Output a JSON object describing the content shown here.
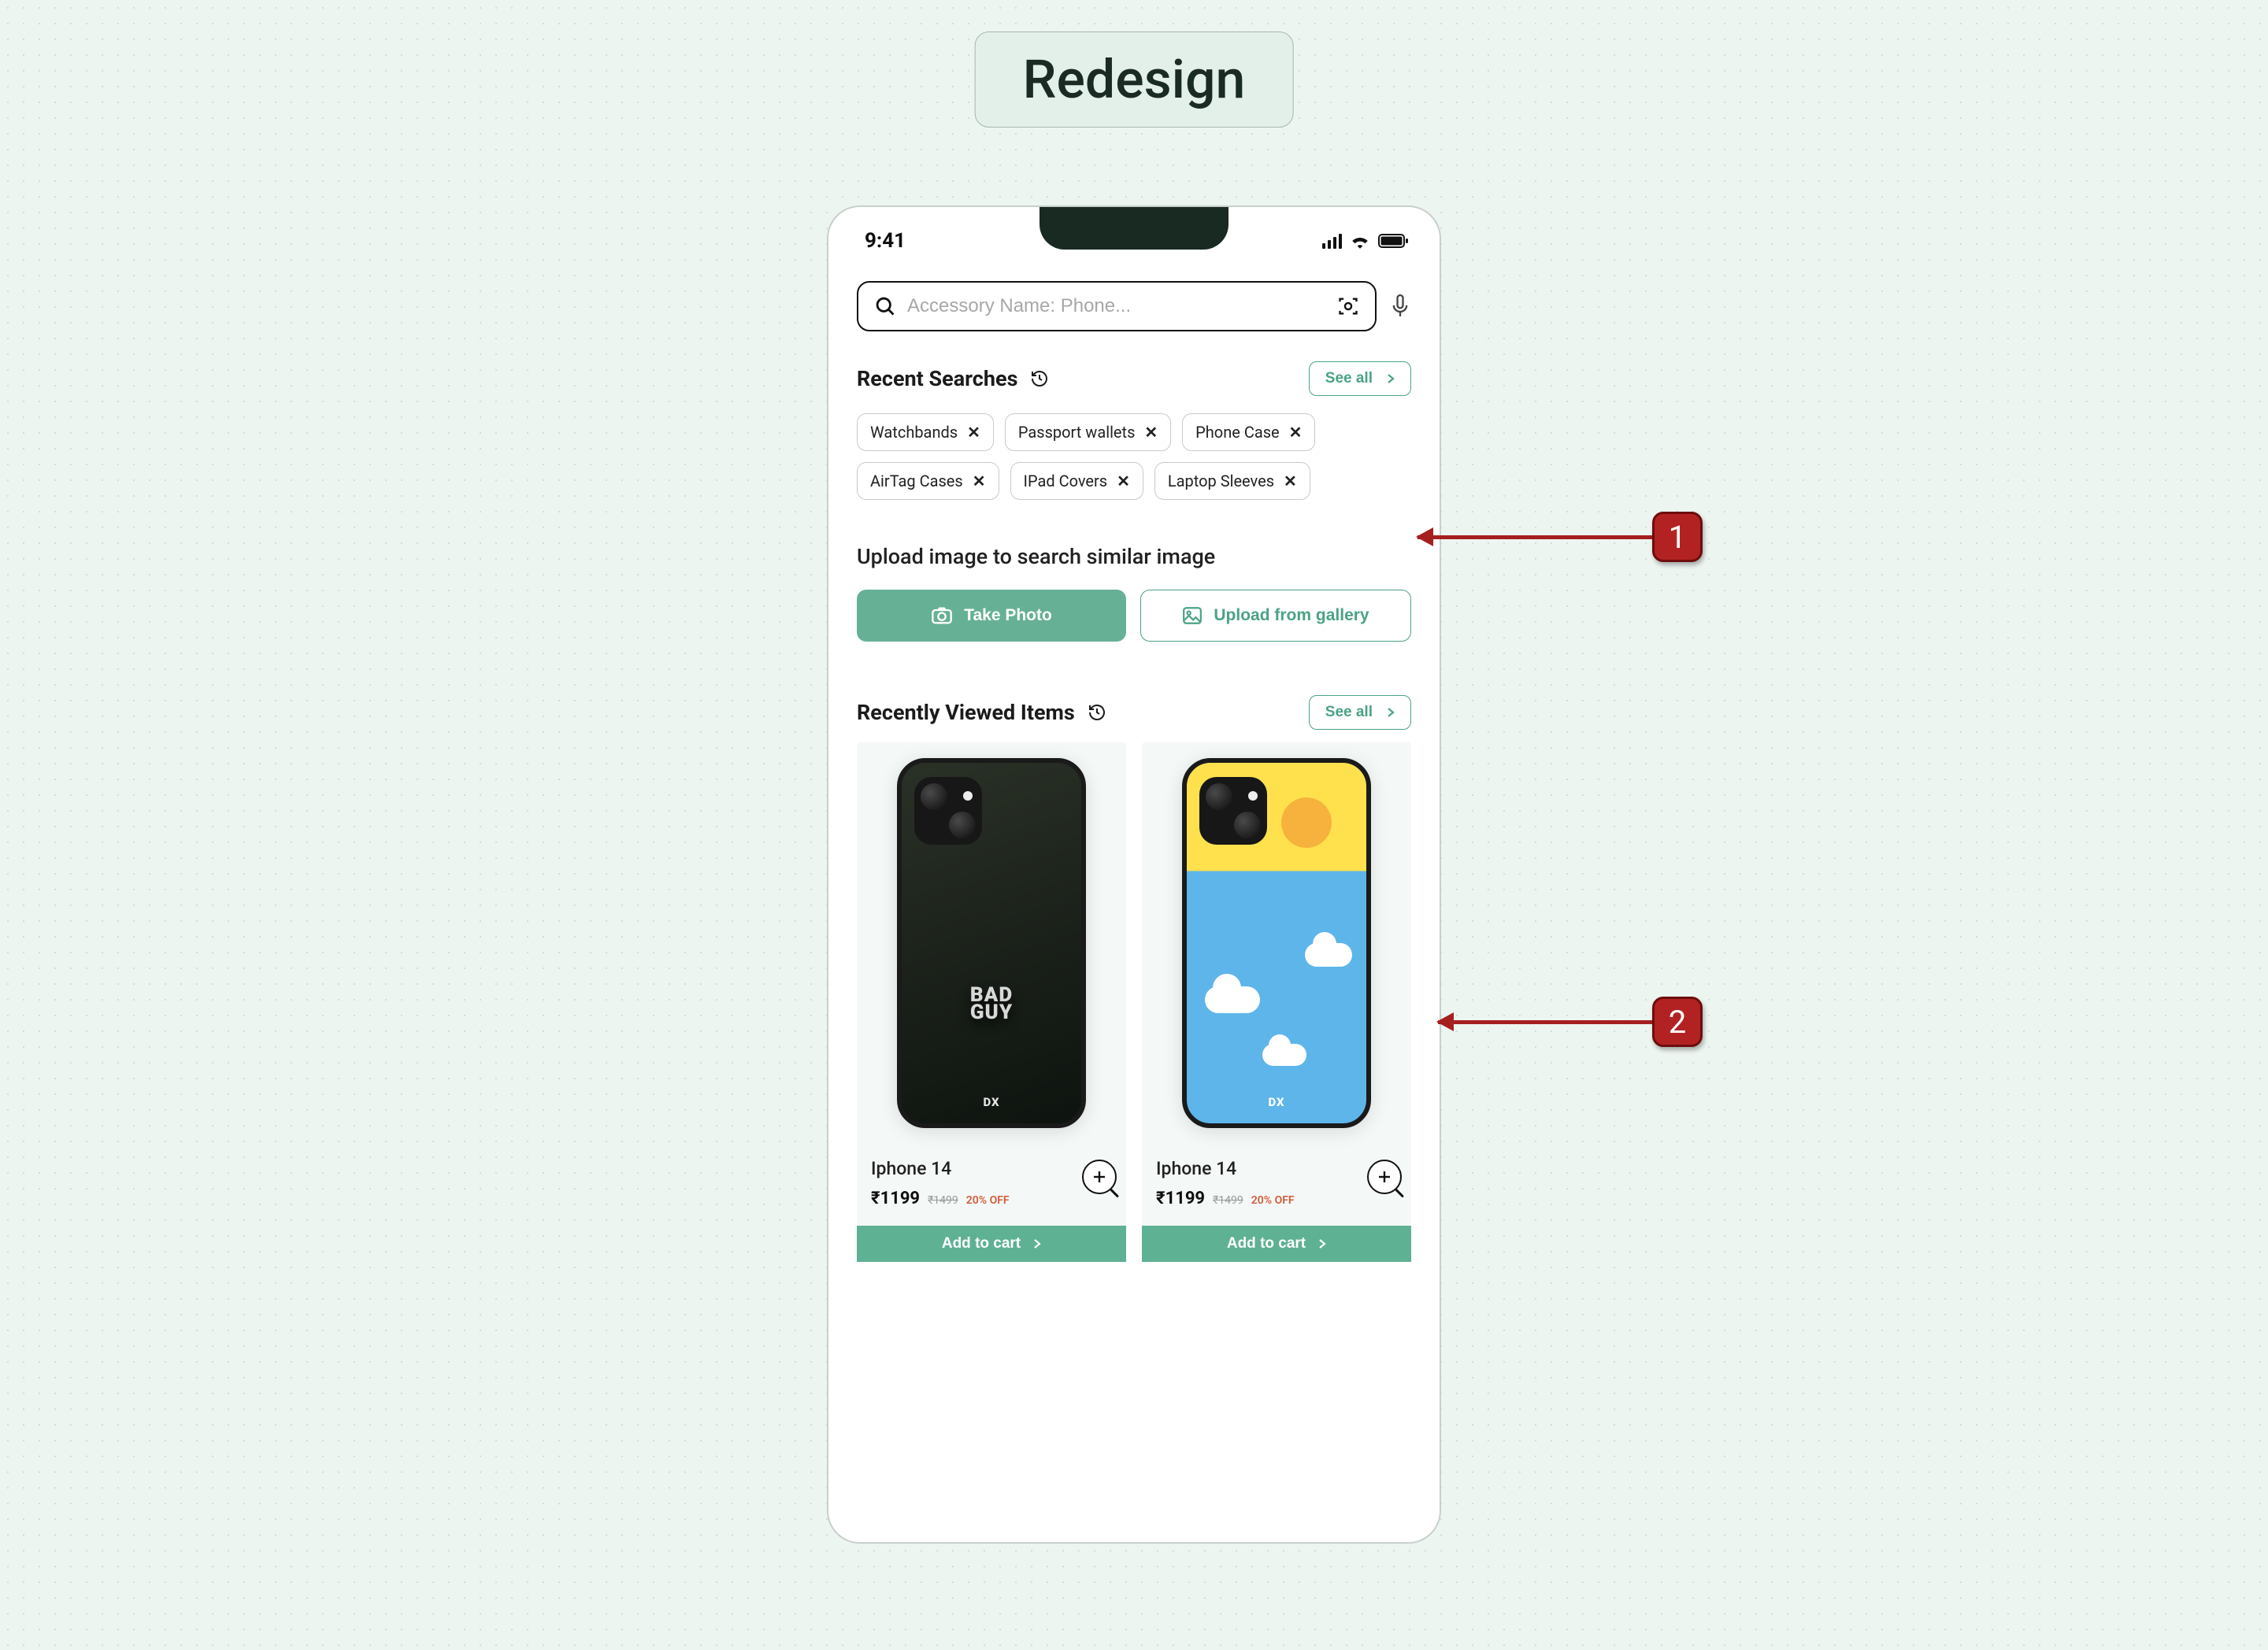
{
  "header": {
    "title": "Redesign"
  },
  "statusBar": {
    "time": "9:41"
  },
  "search": {
    "placeholder": "Accessory Name: Phone..."
  },
  "recent": {
    "title": "Recent Searches",
    "seeAll": "See all",
    "chips": [
      "Watchbands",
      "Passport wallets",
      "Phone Case",
      "AirTag Cases",
      "IPad Covers",
      "Laptop Sleeves"
    ]
  },
  "upload": {
    "title": "Upload image to search similar image",
    "takePhoto": "Take Photo",
    "gallery": "Upload from gallery"
  },
  "viewed": {
    "title": "Recently Viewed Items",
    "seeAll": "See all"
  },
  "products": [
    {
      "name": "Iphone 14",
      "price": "₹1199",
      "orig": "₹1499",
      "discount": "20% OFF",
      "cart": "Add to cart"
    },
    {
      "name": "Iphone 14",
      "price": "₹1199",
      "orig": "₹1499",
      "discount": "20% OFF",
      "cart": "Add to cart"
    }
  ],
  "annotations": {
    "m1": "1",
    "m2": "2"
  }
}
